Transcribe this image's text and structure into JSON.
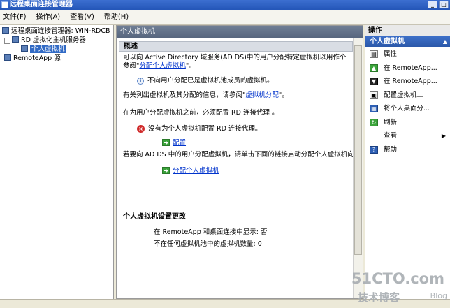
{
  "window": {
    "title": "远程桌面连接管理器",
    "min": "_",
    "max": "□"
  },
  "menu": [
    "文件(F)",
    "操作(A)",
    "查看(V)",
    "帮助(H)"
  ],
  "tree": {
    "root": "远程桌面连接管理器: WIN-RDCB",
    "rd_server": "RD 虚拟化主机服务器",
    "personal_vm": "个人虚拟机",
    "remoteapp": "RemoteApp 源"
  },
  "center": {
    "header": "个人虚拟机",
    "overview_heading": "概述",
    "intro_line1": "可以向 Active Directory 域服务(AD DS)中的用户分配特定虚拟机以用作个",
    "intro_line2_prefix": "参阅\"",
    "intro_line2_link": "分配个人虚拟机",
    "intro_line2_suffix": "\"。",
    "info_note": "不向用户分配已是虚拟机池成员的虚拟机。",
    "vm_assign_prefix": "有关列出虚拟机及其分配的信息，请参阅\"",
    "vm_assign_link": "虚拟机分配",
    "vm_assign_suffix": "\"。",
    "broker_note": "在为用户分配虚拟机之前，必须配置 RD 连接代理 。",
    "error_note": "没有为个人虚拟机配置 RD 连接代理。",
    "configure_link": "配置",
    "wizard_note": "若要向 AD DS 中的用户分配虚拟机，请单击下面的链接启动分配个人虚拟机向",
    "assign_link": "分配个人虚拟机",
    "changes_heading": "个人虚拟机设置更改",
    "change1": "在 RemoteApp 和桌面连接中显示: 否",
    "change2": "不在任何虚拟机池中的虚拟机数量: 0"
  },
  "actions": {
    "heading": "操作",
    "sub": "个人虚拟机",
    "items": [
      "属性",
      "在 RemoteApp...",
      "在 RemoteApp...",
      "配置虚拟机...",
      "将个人桌面分...",
      "刷新",
      "查看",
      "帮助"
    ]
  },
  "watermark": {
    "site": "51CTO.com",
    "cn": "技术博客",
    "blog": "Blog"
  }
}
